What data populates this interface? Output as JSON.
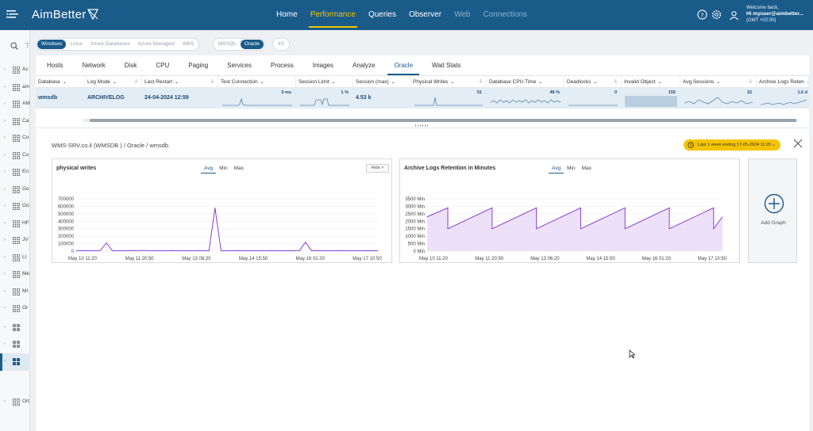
{
  "app": {
    "brand": "AimBetter",
    "nav": [
      {
        "label": "Home",
        "state": "normal"
      },
      {
        "label": "Performance",
        "state": "active"
      },
      {
        "label": "Queries",
        "state": "normal"
      },
      {
        "label": "Observer",
        "state": "normal"
      },
      {
        "label": "Web",
        "state": "dim"
      },
      {
        "label": "Connections",
        "state": "dim"
      }
    ],
    "user": {
      "welcome": "Welcome back,",
      "greeting": "Hi myuser@aimbetter...",
      "timezone": "(GMT +02:00)"
    },
    "colors": {
      "header": "#1a5b8a",
      "accent": "#f5c400"
    }
  },
  "sidebar": {
    "items": [
      {
        "label": "Ac",
        "icon": "grid-icon"
      },
      {
        "label": "am",
        "icon": "grid-icon"
      },
      {
        "label": "AM",
        "icon": "grid-icon"
      },
      {
        "label": "Ca",
        "icon": "grid-icon"
      },
      {
        "label": "Co",
        "icon": "grid-icon"
      },
      {
        "label": "Co",
        "icon": "grid-icon"
      },
      {
        "label": "En",
        "icon": "grid-icon"
      },
      {
        "label": "Go",
        "icon": "grid-icon"
      },
      {
        "label": "Go",
        "icon": "grid-icon"
      },
      {
        "label": "HF",
        "icon": "grid-icon"
      },
      {
        "label": "JV",
        "icon": "grid-icon"
      },
      {
        "label": "LI",
        "icon": "grid-icon"
      },
      {
        "label": "Me",
        "icon": "grid-icon"
      },
      {
        "label": "MI",
        "icon": "grid-icon"
      },
      {
        "label": "Or",
        "icon": "grid-icon"
      },
      {
        "label": "",
        "icon": "windows-icon"
      },
      {
        "label": "",
        "icon": "windows-icon"
      },
      {
        "label": "",
        "icon": "windows-icon",
        "selected": true
      },
      {
        "label": "Ort",
        "icon": "grid-icon"
      }
    ]
  },
  "filters": {
    "os": [
      "Windows",
      "Linux",
      "Azure Databases",
      "Azure Managed",
      "AWS"
    ],
    "os_active": "Windows",
    "db": [
      "MSSQL",
      "Oracle"
    ],
    "db_active": "Oracle",
    "web": [
      "IIS"
    ]
  },
  "tabs": [
    "Hosts",
    "Network",
    "Disk",
    "CPU",
    "Paging",
    "Services",
    "Process",
    "Images",
    "Analyze",
    "Oracle",
    "Wait Stats"
  ],
  "active_tab": "Oracle",
  "grid": {
    "columns": [
      "Database",
      "Log Mode",
      "Last Restart",
      "Test Connection",
      "Session Limit",
      "Session (max)",
      "Physical Writes",
      "Database CPU Time",
      "Deadlocks",
      "Invalid Object",
      "Avg.Sessions",
      "Archive Logs Reten"
    ],
    "row": {
      "database": "wmsdb",
      "log_mode": "ARCHIVELOG",
      "last_restart": "24-04-2024 12:59",
      "test_connection": "0 ms",
      "session_limit": "1 %",
      "session_max": "4.53 k",
      "physical_writes": "51",
      "cpu_time": "48 %",
      "deadlocks": "0",
      "invalid_object": "155",
      "avg_sessions": "15",
      "archive_logs": "1.6 d"
    }
  },
  "detail": {
    "breadcrumb": "WMS-SRV.co.il (WMSDB ) / Oracle / wmsdb",
    "time_range": "Last 1 week ending  17-05-2024 11:20",
    "add_graph": "Add Graph",
    "hide_label": "Hide"
  },
  "chart_data": [
    {
      "type": "line",
      "title": "physical writes",
      "stat_tabs": [
        "Avg",
        "Min",
        "Max"
      ],
      "active_stat": "Avg",
      "ylim": [
        0,
        700000
      ],
      "yticks": [
        "700000",
        "600000",
        "500000",
        "400000",
        "300000",
        "200000",
        "100000",
        "0"
      ],
      "xticks": [
        "May 10 11:20",
        "May 11 20:50",
        "May 13 06:20",
        "May 14 15:50",
        "May 16 01:20",
        "May 17 10:50"
      ],
      "series": [
        {
          "color": "#8a3fd1",
          "x": [
            0,
            0.02,
            0.04,
            0.06,
            0.08,
            0.1,
            0.12,
            0.14,
            0.16,
            0.18,
            0.2,
            0.22,
            0.24,
            0.26,
            0.28,
            0.3,
            0.32,
            0.34,
            0.36,
            0.38,
            0.4,
            0.42,
            0.44,
            0.46,
            0.48,
            0.5,
            0.52,
            0.54,
            0.56,
            0.58,
            0.6,
            0.62,
            0.64,
            0.66,
            0.68,
            0.7,
            0.72,
            0.74,
            0.76,
            0.78,
            0.8,
            0.82,
            0.84,
            0.86,
            0.88,
            0.9,
            0.92,
            0.94,
            0.96,
            0.98,
            1
          ],
          "y": [
            5000,
            8000,
            6000,
            5000,
            7000,
            110000,
            6000,
            7000,
            5000,
            8000,
            6000,
            9000,
            6000,
            7000,
            5000,
            6000,
            8000,
            7000,
            6000,
            5000,
            8000,
            7000,
            6000,
            580000,
            5000,
            7000,
            6000,
            8000,
            5000,
            6000,
            7000,
            5000,
            8000,
            6000,
            7000,
            5000,
            6000,
            7000,
            120000,
            6000,
            8000,
            5000,
            7000,
            6000,
            8000,
            5000,
            7000,
            6000,
            5000,
            6000,
            5000
          ]
        }
      ]
    },
    {
      "type": "area",
      "title": "Archive Logs Retention in Minutes",
      "stat_tabs": [
        "Avg",
        "Min",
        "Max"
      ],
      "active_stat": "Avg",
      "ylim": [
        0,
        3500
      ],
      "yticks": [
        "3500 Min",
        "3000 Min",
        "2500 Min",
        "2000 Min",
        "1500 Min",
        "1000 Min",
        "500 Min",
        "0 Min"
      ],
      "xticks": [
        "May 10 11:20",
        "May 11 20:50",
        "May 13 06:20",
        "May 14 15:50",
        "May 16 01:20",
        "May 17 10:50"
      ],
      "series": [
        {
          "color": "#8a3fd1",
          "fill": "#e8d9f7",
          "x": [
            0,
            0.07,
            0.07,
            0.22,
            0.22,
            0.37,
            0.37,
            0.52,
            0.52,
            0.67,
            0.67,
            0.82,
            0.82,
            0.97,
            0.97,
            1
          ],
          "y": [
            2300,
            2900,
            1500,
            2900,
            1500,
            2900,
            1500,
            2900,
            1500,
            2900,
            1500,
            2900,
            1500,
            2900,
            1500,
            2300
          ]
        }
      ]
    }
  ]
}
